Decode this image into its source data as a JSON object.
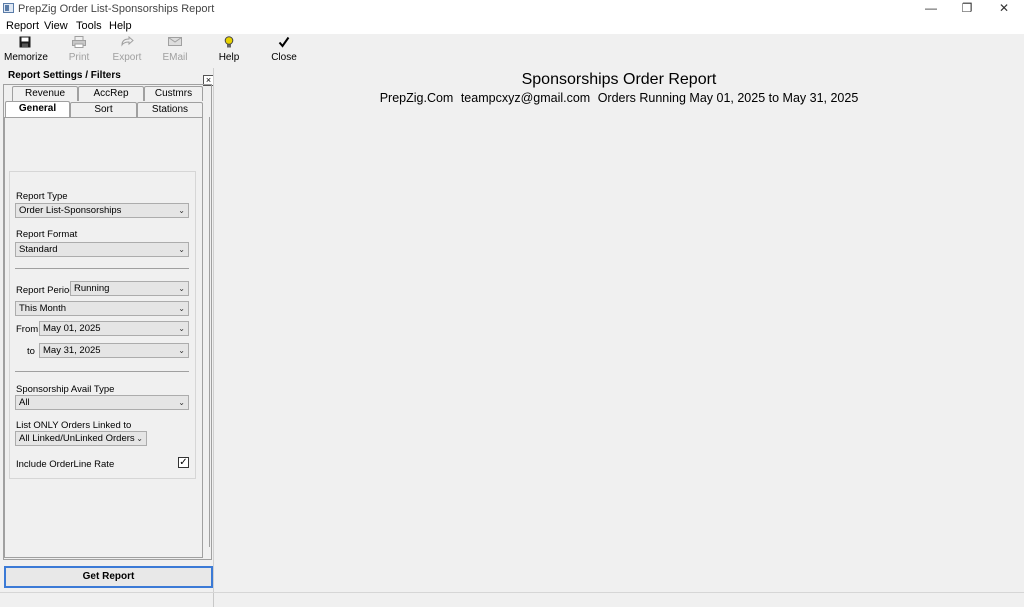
{
  "window": {
    "title": "PrepZig Order List-Sponsorships Report",
    "minimize": "—",
    "restore": "❐",
    "close": "✕"
  },
  "menu": [
    "Report",
    "View",
    "Tools",
    "Help"
  ],
  "toolbar": {
    "memorize": "Memorize",
    "print": "Print",
    "export": "Export",
    "email": "EMail",
    "help": "Help",
    "close": "Close"
  },
  "panel": {
    "title": "Report Settings / Filters",
    "close_glyph": "×",
    "tabs_row1": [
      "Revenue",
      "AccRep",
      "Custmrs"
    ],
    "tabs_row2": [
      "General",
      "Sort",
      "Stations"
    ],
    "active_tab": "General"
  },
  "form": {
    "report_type_label": "Report Type",
    "report_type_value": "Order List-Sponsorships",
    "report_format_label": "Report Format",
    "report_format_value": "Standard",
    "report_period_label": "Report Period",
    "report_period_value": "Running",
    "period_range_value": "This Month",
    "from_label": "From",
    "from_value": "May 01, 2025",
    "to_label": "to",
    "to_value": "May 31, 2025",
    "avail_type_label": "Sponsorship Avail Type",
    "avail_type_value": "All",
    "linked_label": "List ONLY Orders Linked to",
    "linked_value": "All Linked/UnLinked Orders",
    "include_rate_label": "Include OrderLine Rate",
    "include_rate_checked": "✓"
  },
  "get_report": "Get Report",
  "report": {
    "title": "Sponsorships Order Report",
    "company": "PrepZig.Com",
    "email": "teampcxyz@gmail.com",
    "period_text": "Orders Running May 01, 2025 to May 31, 2025"
  },
  "colors": {
    "accent": "#3b7ad6",
    "background": "#f0f0f0"
  },
  "icons": {
    "memorize": "floppy-disk-icon",
    "print": "printer-icon",
    "export": "export-arrow-icon",
    "email": "envelope-icon",
    "help": "lightbulb-icon",
    "close": "checkmark-icon"
  }
}
